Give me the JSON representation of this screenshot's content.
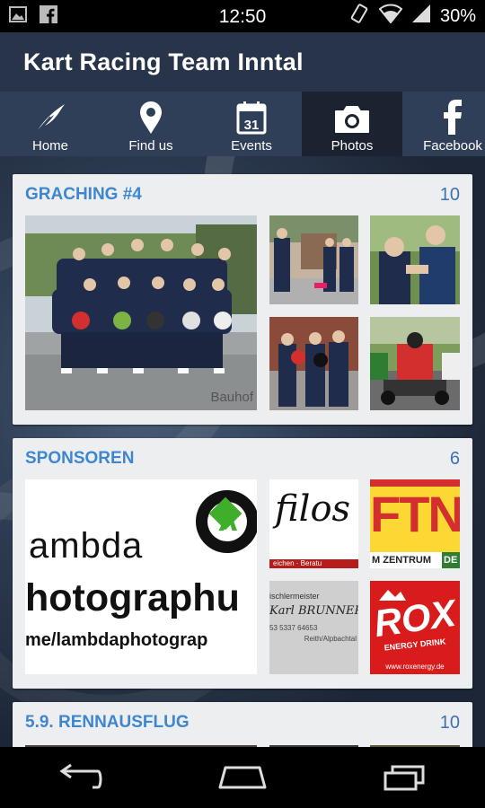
{
  "status_bar": {
    "time": "12:50",
    "battery": "30%"
  },
  "app": {
    "title": "Kart Racing Team Inntal"
  },
  "tabs": [
    {
      "label": "Home",
      "icon": "feather-icon"
    },
    {
      "label": "Find us",
      "icon": "map-pin-icon"
    },
    {
      "label": "Events",
      "icon": "calendar-icon",
      "icon_text": "31"
    },
    {
      "label": "Photos",
      "icon": "camera-icon",
      "active": true
    },
    {
      "label": "Facebook",
      "icon": "facebook-icon"
    }
  ],
  "albums": [
    {
      "title": "GRACHING #4",
      "count": "10",
      "photo_caption": "Bauhof"
    },
    {
      "title": "SPONSOREN",
      "count": "6",
      "sponsors": {
        "lambda_line1": "ambda",
        "lambda_line2": "hotographu",
        "lambda_line3": "me/lambdaphotograp",
        "lambda_symbol": "λ",
        "filos": "filos",
        "filos_sub": "eichen · Beratu",
        "ftn": "FTN",
        "ftn_sub": "M ZENTRUM",
        "ftn_badge": "DE",
        "brunner_l1": "ischlermeister",
        "brunner_l2": "Karl BRUNNER",
        "brunner_l3": "53 5337 64653",
        "brunner_l4": "Reith/Alpbachtal",
        "rox": "ROX",
        "rox_sub": "ENERGY DRINK",
        "rox_url": "www.roxenergy.de"
      }
    },
    {
      "title": "5.9. RENNAUSFLUG",
      "count": "10"
    }
  ],
  "colors": {
    "accent": "#3f86d1",
    "appbar": "#28344a",
    "tabbar": "#303f58"
  }
}
